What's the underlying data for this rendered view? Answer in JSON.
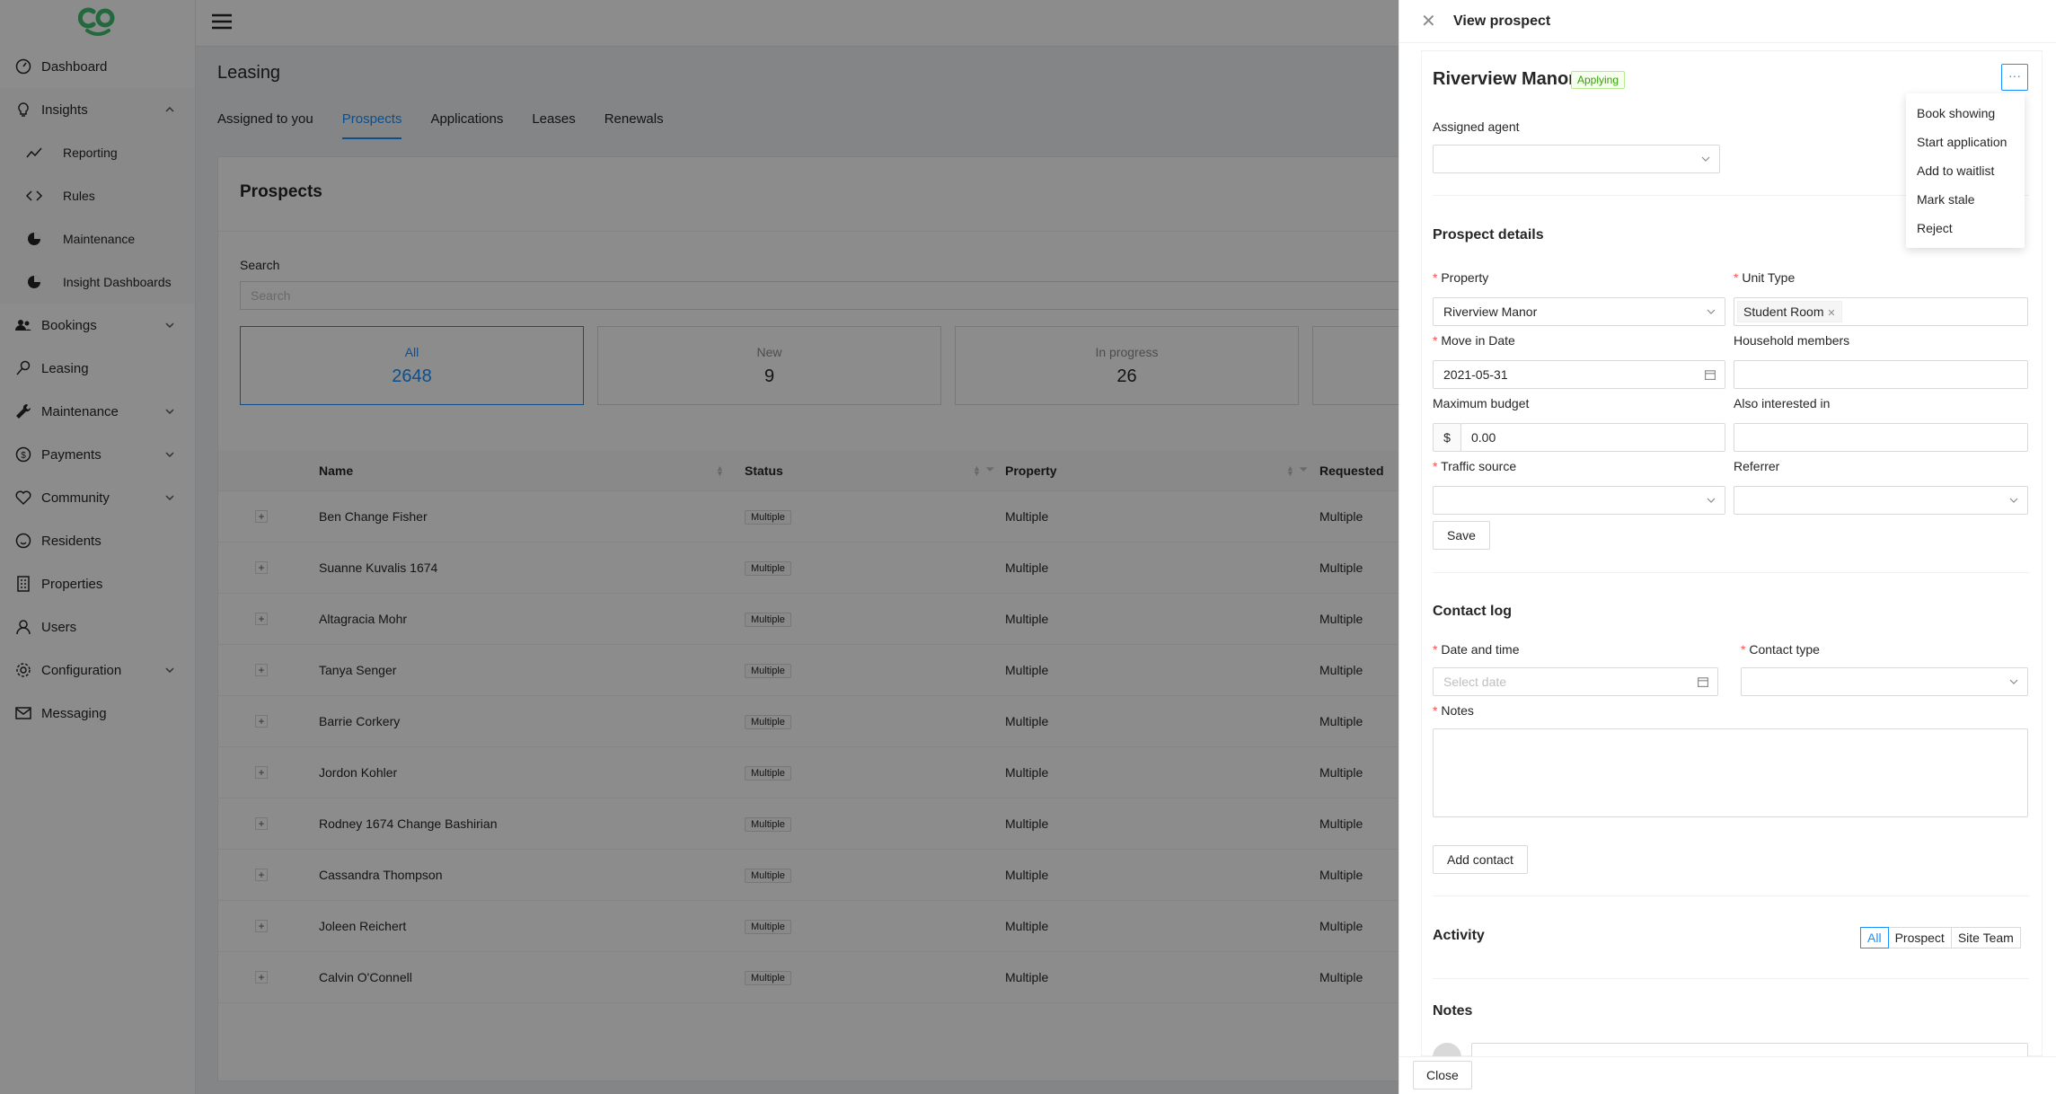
{
  "sidebar": {
    "items": [
      {
        "label": "Dashboard"
      },
      {
        "label": "Insights"
      },
      {
        "label": "Reporting"
      },
      {
        "label": "Rules"
      },
      {
        "label": "Maintenance"
      },
      {
        "label": "Insight Dashboards"
      },
      {
        "label": "Bookings"
      },
      {
        "label": "Leasing"
      },
      {
        "label": "Maintenance"
      },
      {
        "label": "Payments"
      },
      {
        "label": "Community"
      },
      {
        "label": "Residents"
      },
      {
        "label": "Properties"
      },
      {
        "label": "Users"
      },
      {
        "label": "Configuration"
      },
      {
        "label": "Messaging"
      }
    ]
  },
  "page": {
    "title": "Leasing",
    "tabs": [
      {
        "label": "Assigned to you"
      },
      {
        "label": "Prospects"
      },
      {
        "label": "Applications"
      },
      {
        "label": "Leases"
      },
      {
        "label": "Renewals"
      }
    ],
    "card_title": "Prospects",
    "search_label": "Search",
    "search_placeholder": "Search",
    "stats": [
      {
        "label": "All",
        "value": "2648"
      },
      {
        "label": "New",
        "value": "9"
      },
      {
        "label": "In progress",
        "value": "26"
      }
    ]
  },
  "table": {
    "headers": {
      "name": "Name",
      "status": "Status",
      "property": "Property",
      "requested": "Requested"
    },
    "rows": [
      {
        "name": "Ben Change Fisher",
        "status": "Multiple",
        "property": "Multiple",
        "requested": "Multiple"
      },
      {
        "name": "Suanne Kuvalis 1674",
        "status": "Multiple",
        "property": "Multiple",
        "requested": "Multiple"
      },
      {
        "name": "Altagracia Mohr",
        "status": "Multiple",
        "property": "Multiple",
        "requested": "Multiple"
      },
      {
        "name": "Tanya Senger",
        "status": "Multiple",
        "property": "Multiple",
        "requested": "Multiple"
      },
      {
        "name": "Barrie Corkery",
        "status": "Multiple",
        "property": "Multiple",
        "requested": "Multiple"
      },
      {
        "name": "Jordon Kohler",
        "status": "Multiple",
        "property": "Multiple",
        "requested": "Multiple"
      },
      {
        "name": "Rodney 1674 Change Bashirian",
        "status": "Multiple",
        "property": "Multiple",
        "requested": "Multiple"
      },
      {
        "name": "Cassandra Thompson",
        "status": "Multiple",
        "property": "Multiple",
        "requested": "Multiple"
      },
      {
        "name": "Joleen Reichert",
        "status": "Multiple",
        "property": "Multiple",
        "requested": "Multiple"
      },
      {
        "name": "Calvin O'Connell",
        "status": "Multiple",
        "property": "Multiple",
        "requested": "Multiple"
      }
    ]
  },
  "drawer": {
    "title": "View prospect",
    "prospect_name": "Riverview Manor",
    "status_tag": "Applying",
    "more_label": "···",
    "menu": [
      "Book showing",
      "Start application",
      "Add to waitlist",
      "Mark stale",
      "Reject"
    ],
    "assigned_agent_label": "Assigned agent",
    "details_title": "Prospect details",
    "property_label": "Property",
    "property_value": "Riverview Manor",
    "unit_type_label": "Unit Type",
    "unit_type_tag": "Student Room",
    "move_in_label": "Move in Date",
    "move_in_value": "2021-05-31",
    "household_label": "Household members",
    "budget_label": "Maximum budget",
    "budget_prefix": "$",
    "budget_value": "0.00",
    "also_label": "Also interested in",
    "traffic_label": "Traffic source",
    "referrer_label": "Referrer",
    "save_label": "Save",
    "contact_title": "Contact log",
    "date_label": "Date and time",
    "date_placeholder": "Select date",
    "contact_type_label": "Contact type",
    "notes_label": "Notes",
    "add_contact_label": "Add contact",
    "activity_title": "Activity",
    "activity_filters": [
      "All",
      "Prospect",
      "Site Team"
    ],
    "notes_title": "Notes",
    "close_label": "Close"
  },
  "colors": {
    "accent": "#1890ff",
    "logo": "#3fbf6f",
    "tag_green": "#389e0d"
  }
}
